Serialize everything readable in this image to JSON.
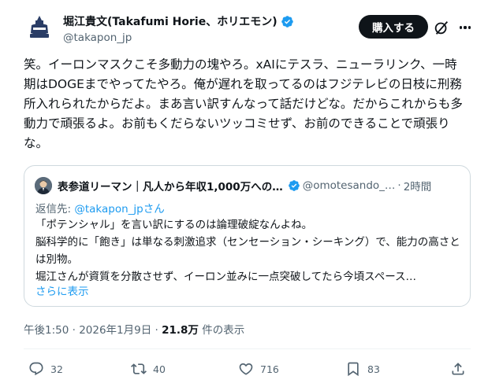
{
  "author": {
    "name": "堀江貴文(Takafumi Horie、ホリエモン)",
    "handle": "@takapon_jp"
  },
  "header": {
    "buy_label": "購入する"
  },
  "tweet": {
    "text": "笑。イーロンマスクこそ多動力の塊やろ。xAIにテスラ、ニューラリンク、一時期はDOGEまでやってたやろ。俺が遅れを取ってるのはフジテレビの日枝に刑務所入れられたからだよ。まあ言い訳すんなって話だけどな。だからこれからも多動力で頑張るよ。お前もくだらないツッコミせず、お前のできることで頑張りな。"
  },
  "quote": {
    "name": "表参道リーマン｜凡人から年収1,000万への…",
    "handle": "@omotesando_…",
    "time": "2時間",
    "reply_prefix": "返信先: ",
    "reply_to": "@takapon_jpさん",
    "text": "「ポテンシャル」を言い訳にするのは論理破綻なんよね。\n脳科学的に「飽き」は単なる刺激追求（センセーション・シーキング）で、能力の高さとは別物。\n堀江さんが資質を分散させず、イーロン並みに一点突破してたら今頃スペース…",
    "show_more": "さらに表示"
  },
  "meta": {
    "time": "午後1:50 · 2026年1月9日 · ",
    "views": "21.8万",
    "views_label": " 件の表示"
  },
  "actions": {
    "replies": "32",
    "reposts": "40",
    "likes": "716",
    "bookmarks": "83"
  },
  "colors": {
    "accent": "#1d9bf0",
    "secondary_text": "#536471",
    "verified": "#1d9bf0"
  }
}
